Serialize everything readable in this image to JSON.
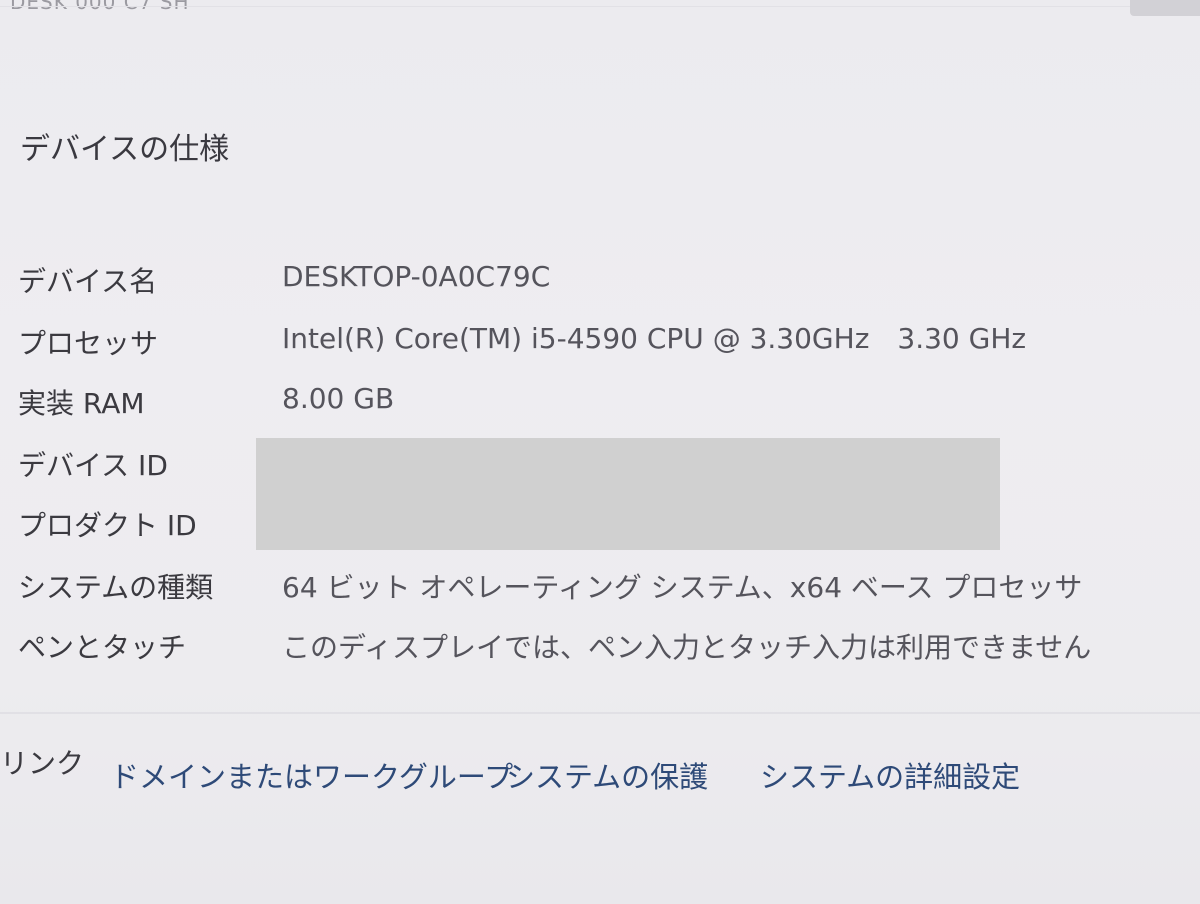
{
  "top_fragment": "DESK 000 C7 SH",
  "section_title": "デバイスの仕様",
  "specs": [
    {
      "label": "デバイス名",
      "value": "DESKTOP-0A0C79C"
    },
    {
      "label": "プロセッサ",
      "value": "Intel(R) Core(TM) i5-4590 CPU @ 3.30GHz",
      "value2": "3.30 GHz"
    },
    {
      "label": "実装 RAM",
      "value": "8.00 GB"
    },
    {
      "label": "デバイス ID",
      "value": ""
    },
    {
      "label": "プロダクト ID",
      "value": ""
    },
    {
      "label": "システムの種類",
      "value": "64 ビット オペレーティング システム、x64 ベース プロセッサ"
    },
    {
      "label": "ペンとタッチ",
      "value": "このディスプレイでは、ペン入力とタッチ入力は利用できません"
    }
  ],
  "links": {
    "label": "リンク",
    "items": [
      {
        "label": "ドメインまたはワークグループ"
      },
      {
        "label": "システムの保護"
      },
      {
        "label": "システムの詳細設定"
      }
    ]
  },
  "colors": {
    "background": "#edecf0",
    "text": "#3b3a40",
    "value_text": "#55545c",
    "link": "#2e4a78",
    "redaction": "#d0d0d0"
  }
}
